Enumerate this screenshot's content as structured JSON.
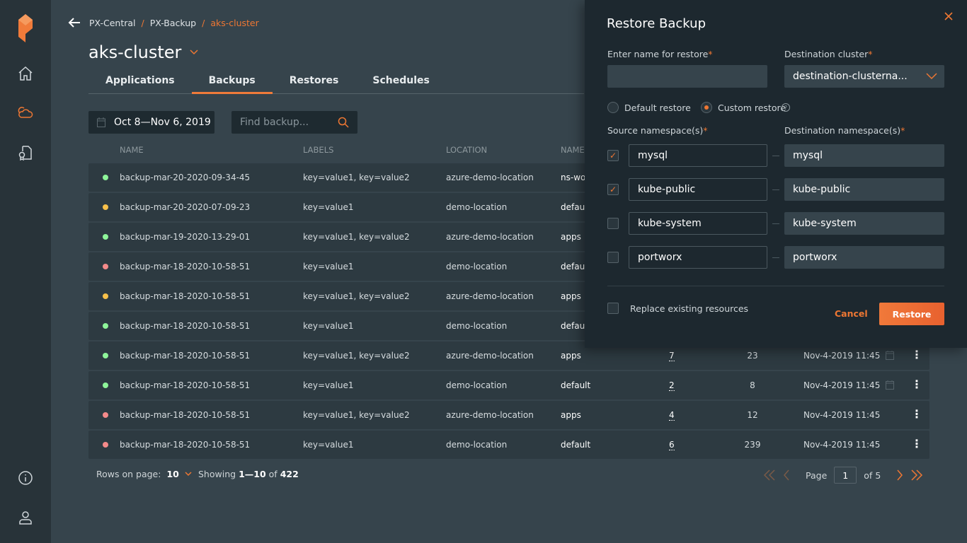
{
  "sidebar": {
    "items": [
      {
        "icon": "portworx-logo"
      },
      {
        "icon": "home-icon"
      },
      {
        "icon": "cloud-icon",
        "active": true
      },
      {
        "icon": "certificate-doc-icon"
      },
      {
        "icon": "info-icon"
      },
      {
        "icon": "user-icon"
      }
    ]
  },
  "breadcrumb": [
    "PX-Central",
    "PX-Backup",
    "aks-cluster"
  ],
  "page_title": "aks-cluster",
  "tabs": [
    "Applications",
    "Backups",
    "Restores",
    "Schedules"
  ],
  "active_tab": "Backups",
  "filters": {
    "date_range": "Oct 8—Nov 6, 2019",
    "search_placeholder": "Find backup..."
  },
  "table": {
    "headers": [
      "NAME",
      "LABELS",
      "LOCATION",
      "NAME"
    ],
    "rows": [
      {
        "status": "green",
        "name": "backup-mar-20-2020-09-34-45",
        "labels": "key=value1, key=value2",
        "location": "azure-demo-location",
        "namespace": "ns-wo"
      },
      {
        "status": "yellow",
        "name": "backup-mar-20-2020-07-09-23",
        "labels": "key=value1",
        "location": "demo-location",
        "namespace": "default"
      },
      {
        "status": "green",
        "name": "backup-mar-19-2020-13-29-01",
        "labels": "key=value1, key=value2",
        "location": "azure-demo-location",
        "namespace": "apps"
      },
      {
        "status": "red",
        "name": "backup-mar-18-2020-10-58-51",
        "labels": "key=value1",
        "location": "demo-location",
        "namespace": "default"
      },
      {
        "status": "yellow",
        "name": "backup-mar-18-2020-10-58-51",
        "labels": "key=value1, key=value2",
        "location": "azure-demo-location",
        "namespace": "apps"
      },
      {
        "status": "green",
        "name": "backup-mar-18-2020-10-58-51",
        "labels": "key=value1",
        "location": "demo-location",
        "namespace": "default"
      },
      {
        "status": "green",
        "name": "backup-mar-18-2020-10-58-51",
        "labels": "key=value1, key=value2",
        "location": "azure-demo-location",
        "namespace": "apps",
        "count": "7",
        "size": "23",
        "date": "Nov-4-2019 11:45",
        "scheduled": true
      },
      {
        "status": "green",
        "name": "backup-mar-18-2020-10-58-51",
        "labels": "key=value1",
        "location": "demo-location",
        "namespace": "default",
        "count": "2",
        "size": "8",
        "date": "Nov-4-2019 11:45",
        "scheduled": true
      },
      {
        "status": "red",
        "name": "backup-mar-18-2020-10-58-51",
        "labels": "key=value1, key=value2",
        "location": "azure-demo-location",
        "namespace": "apps",
        "count": "4",
        "size": "12",
        "date": "Nov-4-2019 11:45",
        "scheduled": false
      },
      {
        "status": "red",
        "name": "backup-mar-18-2020-10-58-51",
        "labels": "key=value1",
        "location": "demo-location",
        "namespace": "default",
        "count": "6",
        "size": "239",
        "date": "Nov-4-2019 11:45",
        "scheduled": false
      }
    ]
  },
  "pagination": {
    "rows_label": "Rows on page:",
    "rows_value": "10",
    "showing_prefix": "Showing",
    "showing_range": "1—10",
    "showing_of": "of",
    "total": "422",
    "page_label": "Page",
    "page": "1",
    "of_label": "of",
    "pages": "5"
  },
  "colors": {
    "accent": "#ee7733",
    "green": "#8ef59a",
    "yellow": "#f7c04a",
    "red": "#f48a8a"
  },
  "panel": {
    "title": "Restore Backup",
    "name_label": "Enter name for restore",
    "name_value": "",
    "dest_cluster_label": "Destination cluster",
    "dest_cluster_value": "destination-clusterna...",
    "radio_default": "Default restore",
    "radio_custom": "Custom restore",
    "selected_radio": "custom",
    "source_label": "Source namespace(s)",
    "dest_ns_label": "Destination namespace(s)",
    "namespaces": [
      {
        "checked": true,
        "source": "mysql",
        "dest": "mysql"
      },
      {
        "checked": true,
        "source": "kube-public",
        "dest": "kube-public"
      },
      {
        "checked": false,
        "source": "kube-system",
        "dest": "kube-system"
      },
      {
        "checked": false,
        "source": "portworx",
        "dest": "portworx"
      }
    ],
    "replace_label": "Replace existing resources",
    "replace_checked": false,
    "cancel": "Cancel",
    "restore": "Restore",
    "required_mark": "*"
  }
}
